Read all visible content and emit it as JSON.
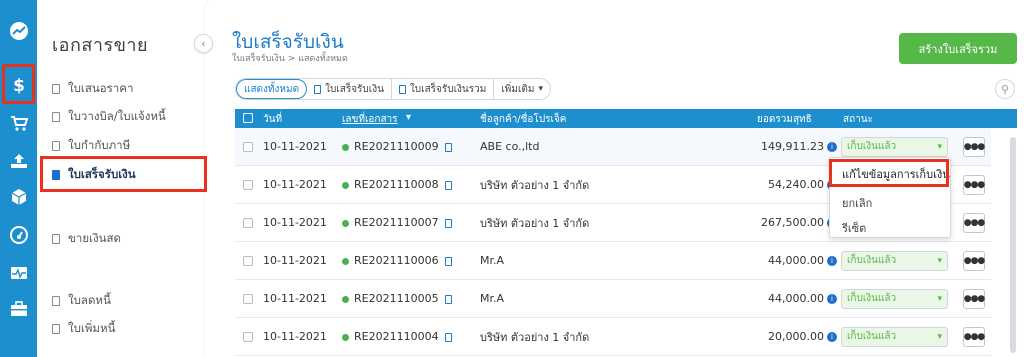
{
  "sidebar": {
    "title": "เอกสารขาย",
    "items": [
      {
        "label": "ใบเสนอราคา"
      },
      {
        "label": "ใบวางบิล/ใบแจ้งหนี้"
      },
      {
        "label": "ใบกำกับภาษี"
      },
      {
        "label": "ใบเสร็จรับเงิน"
      },
      {
        "label": "ขายเงินสด"
      },
      {
        "label": "ใบลดหนี้"
      },
      {
        "label": "ใบเพิ่มหนี้"
      }
    ],
    "active_index": 3
  },
  "rail": {
    "icons": [
      "trend-logo-icon",
      "dollar-icon",
      "cart-icon",
      "upload-tray-icon",
      "box-icon",
      "gauge-icon",
      "pulse-icon",
      "briefcase-icon"
    ],
    "active": "dollar-icon"
  },
  "header": {
    "title": "ใบเสร็จรับเงิน",
    "breadcrumb": "ใบเสร็จรับเงิน > แสดงทั้งหมด",
    "create_label": "สร้างใบเสร็จรวม"
  },
  "tabs": [
    {
      "label": "แสดงทั้งหมด",
      "active": true
    },
    {
      "label": "ใบเสร็จรับเงิน"
    },
    {
      "label": "ใบเสร็จรับเงินรวม"
    },
    {
      "label": "เพิ่มเติม"
    }
  ],
  "table": {
    "columns": [
      "วันที่",
      "เลขที่เอกสาร",
      "ชื่อลูกค้า/ชื่อโปรเจ็ค",
      "ยอดรวมสุทธิ",
      "สถานะ"
    ],
    "rows": [
      {
        "date": "10-11-2021",
        "doc": "RE2021110009",
        "customer": "ABE co.,ltd",
        "total": "149,911.23",
        "status": "เก็บเงินแล้ว"
      },
      {
        "date": "10-11-2021",
        "doc": "RE2021110008",
        "customer": "บริษัท ตัวอย่าง 1 จำกัด",
        "total": "54,240.00",
        "status": ""
      },
      {
        "date": "10-11-2021",
        "doc": "RE2021110007",
        "customer": "บริษัท ตัวอย่าง 1 จำกัด",
        "total": "267,500.00",
        "status": ""
      },
      {
        "date": "10-11-2021",
        "doc": "RE2021110006",
        "customer": "Mr.A",
        "total": "44,000.00",
        "status": "เก็บเงินแล้ว"
      },
      {
        "date": "10-11-2021",
        "doc": "RE2021110005",
        "customer": "Mr.A",
        "total": "44,000.00",
        "status": "เก็บเงินแล้ว"
      },
      {
        "date": "10-11-2021",
        "doc": "RE2021110004",
        "customer": "บริษัท ตัวอย่าง 1 จำกัด",
        "total": "20,000.00",
        "status": "เก็บเงินแล้ว"
      }
    ]
  },
  "dropdown": {
    "items": [
      "แก้ไขข้อมูลการเก็บเงิน",
      "ยกเลิก",
      "รีเซ็ต"
    ]
  },
  "colors": {
    "accent": "#1d8fce",
    "create_button": "#57b84a",
    "highlight": "#e8321e",
    "status_dot": "#4caf50"
  }
}
